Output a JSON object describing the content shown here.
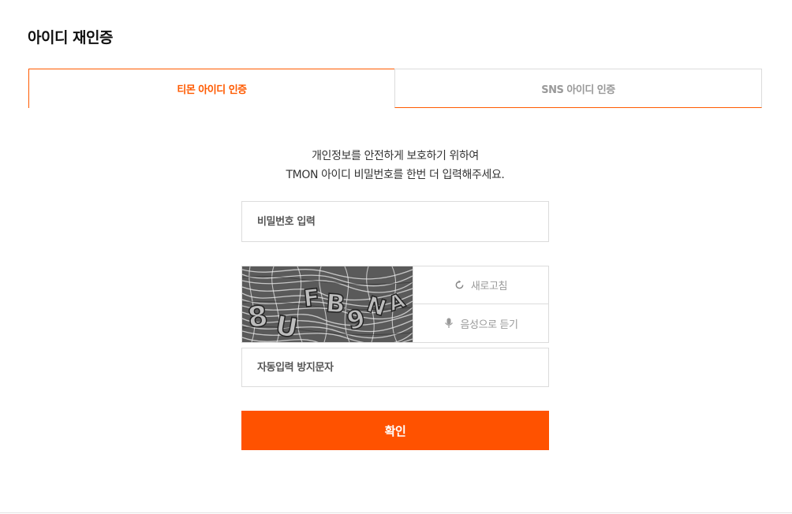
{
  "page": {
    "title": "아이디 재인증"
  },
  "tabs": [
    {
      "label": "티몬 아이디 인증",
      "active": true
    },
    {
      "label": "SNS 아이디 인증",
      "active": false
    }
  ],
  "intro": {
    "line1": "개인정보를 안전하게 보호하기 위하여",
    "line2": "TMON 아이디 비밀번호를 한번 더 입력해주세요."
  },
  "password": {
    "placeholder": "비밀번호 입력",
    "value": ""
  },
  "captcha": {
    "image_text": "8UFB9NA",
    "refresh_label": "새로고침",
    "audio_label": "음성으로 듣기",
    "refresh_icon": "refresh-icon",
    "audio_icon": "microphone-icon"
  },
  "captcha_input": {
    "placeholder": "자동입력 방지문자",
    "value": ""
  },
  "confirm": {
    "label": "확인"
  },
  "colors": {
    "accent": "#ff5a00",
    "button": "#ff5200",
    "border": "#dcdcdc",
    "muted_text": "#999999"
  }
}
